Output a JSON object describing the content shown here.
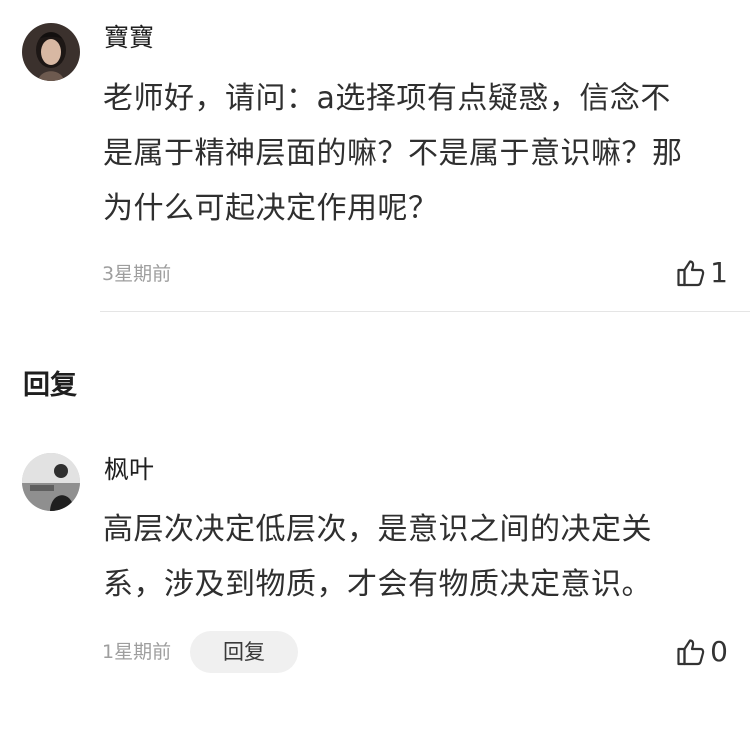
{
  "comment": {
    "username": "寶寶",
    "text_lines": [
      "老师好，请问：a选择项有点疑惑，信念不",
      "是属于精神层面的嘛？不是属于意识嘛？那",
      "为什么可起决定作用呢？"
    ],
    "time": "3星期前",
    "like_count": "1"
  },
  "replies_section": {
    "title": "回复"
  },
  "reply": {
    "username": "枫叶",
    "text_lines": [
      "高层次决定低层次，是意识之间的决定关",
      "系，涉及到物质，才会有物质决定意识。"
    ],
    "time": "1星期前",
    "reply_label": "回复",
    "like_count": "0"
  },
  "icons": {
    "like": "thumbs-up-icon"
  },
  "colors": {
    "text": "#2f2f2f",
    "meta": "#9e9e9e",
    "divider": "#e5e5e5",
    "reply_button_bg": "#f0f0f0"
  }
}
